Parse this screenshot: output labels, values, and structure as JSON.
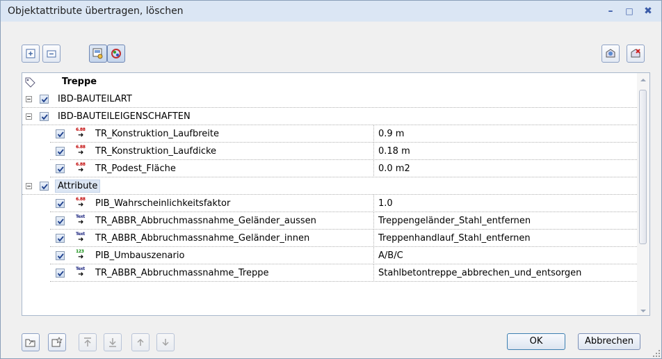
{
  "window": {
    "title": "Objektattribute übertragen, löschen",
    "minimize_glyph": "–",
    "maximize_glyph": "□",
    "close_glyph": "✖"
  },
  "toolbar": {
    "icons": [
      "expand-all-icon",
      "collapse-all-icon",
      "view-mode-icon",
      "color-view-icon",
      "transfer-attributes-icon",
      "delete-attributes-icon"
    ]
  },
  "tree": {
    "root_label": "Treppe",
    "groups": [
      {
        "label": "IBD-BAUTEILART",
        "items": []
      },
      {
        "label": "IBD-BAUTEILEIGENSCHAFTEN",
        "items": [
          {
            "type_icon": "number",
            "type_text": "6.88",
            "name": "TR_Konstruktion_Laufbreite",
            "value": "0.9 m"
          },
          {
            "type_icon": "number",
            "type_text": "6.88",
            "name": "TR_Konstruktion_Laufdicke",
            "value": "0.18 m"
          },
          {
            "type_icon": "number",
            "type_text": "6.88",
            "name": "TR_Podest_Fläche",
            "value": "0.0 m2"
          }
        ]
      },
      {
        "label": "Attribute",
        "items": [
          {
            "type_icon": "number",
            "type_text": "6.88",
            "name": "PIB_Wahrscheinlichkeitsfaktor",
            "value": "1.0"
          },
          {
            "type_icon": "text",
            "type_text": "Text",
            "name": "TR_ABBR_Abbruchmassnahme_Geländer_aussen",
            "value": "Treppengeländer_Stahl_entfernen"
          },
          {
            "type_icon": "text",
            "type_text": "Text",
            "name": "TR_ABBR_Abbruchmassnahme_Geländer_innen",
            "value": "Treppenhandlauf_Stahl_entfernen"
          },
          {
            "type_icon": "enum",
            "type_text": "123",
            "name": "PIB_Umbauszenario",
            "value": "A/B/C"
          },
          {
            "type_icon": "text",
            "type_text": "Text",
            "name": "TR_ABBR_Abbruchmassnahme_Treppe",
            "value": "Stahlbetontreppe_abbrechen_und_entsorgen"
          }
        ]
      }
    ]
  },
  "footer": {
    "ok_label": "OK",
    "cancel_label": "Abbrechen"
  },
  "colors": {
    "number_icon": "#c00000",
    "text_icon": "#1a237e",
    "enum_icon": "#0a8a0a",
    "accent": "#3c7fb1"
  }
}
